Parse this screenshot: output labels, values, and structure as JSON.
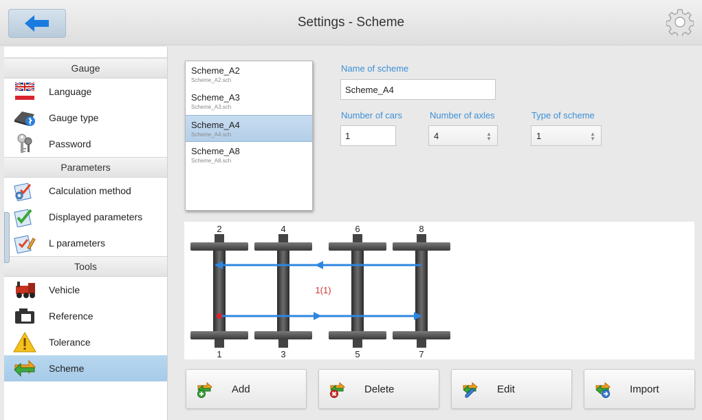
{
  "header": {
    "title": "Settings - Scheme"
  },
  "sidebar": {
    "sections": [
      {
        "title": "Gauge",
        "items": [
          {
            "label": "Language",
            "icon": "flag-icon"
          },
          {
            "label": "Gauge type",
            "icon": "device-icon"
          },
          {
            "label": "Password",
            "icon": "keys-icon"
          }
        ]
      },
      {
        "title": "Parameters",
        "items": [
          {
            "label": "Calculation method",
            "icon": "checklist-gear-icon"
          },
          {
            "label": "Displayed parameters",
            "icon": "checklist-icon"
          },
          {
            "label": "L parameters",
            "icon": "checklist-pencil-icon"
          }
        ]
      },
      {
        "title": "Tools",
        "items": [
          {
            "label": "Vehicle",
            "icon": "locomotive-icon"
          },
          {
            "label": "Reference",
            "icon": "reference-icon"
          },
          {
            "label": "Tolerance",
            "icon": "warning-icon"
          },
          {
            "label": "Scheme",
            "icon": "scheme-arrows-icon",
            "selected": true
          }
        ]
      }
    ]
  },
  "schemes": [
    {
      "name": "Scheme_A2",
      "file": "Scheme_A2.sch"
    },
    {
      "name": "Scheme_A3",
      "file": "Scheme_A3.sch"
    },
    {
      "name": "Scheme_A4",
      "file": "Scheme_A4.sch",
      "selected": true
    },
    {
      "name": "Scheme_A8",
      "file": "Scheme_A8.sch"
    }
  ],
  "form": {
    "name_label": "Name of scheme",
    "name_value": "Scheme_A4",
    "cars_label": "Number of cars",
    "cars_value": "1",
    "axles_label": "Number of axles",
    "axles_value": "4",
    "type_label": "Type of scheme",
    "type_value": "1"
  },
  "diagram": {
    "top_numbers": [
      "2",
      "4",
      "6",
      "8"
    ],
    "bottom_numbers": [
      "1",
      "3",
      "5",
      "7"
    ],
    "car_label": "1(1)"
  },
  "buttons": {
    "add": "Add",
    "delete": "Delete",
    "edit": "Edit",
    "import": "Import"
  },
  "colors": {
    "accent": "#3d8fd6",
    "selected": "#a9cce9",
    "arrow": "#2f86e0",
    "label_red": "#d03030"
  }
}
